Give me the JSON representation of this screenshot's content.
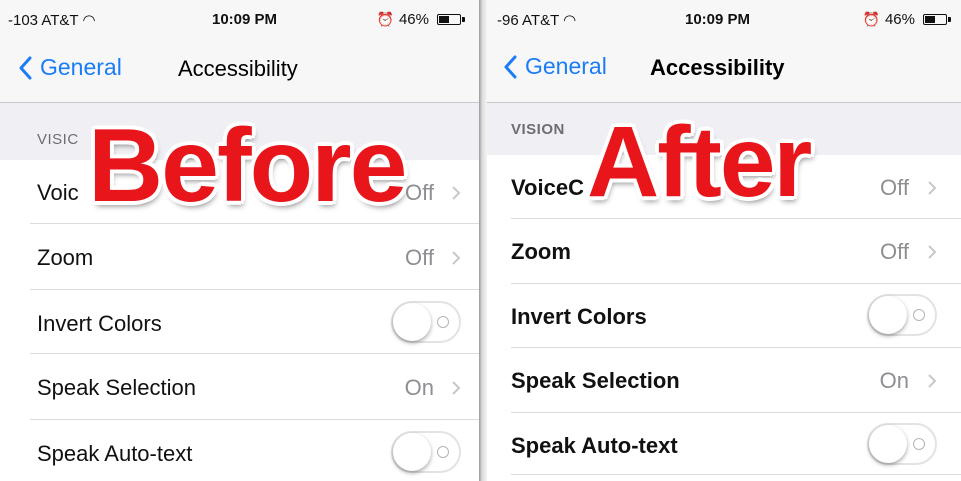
{
  "before": {
    "status_bar": {
      "carrier": "-103 AT&T",
      "time": "10:09 PM",
      "battery": "46%",
      "battery_level": 0.46
    },
    "nav": {
      "back_label": "General",
      "title": "Accessibility"
    },
    "section": {
      "title": "VISIC"
    },
    "rows": [
      {
        "label": "Voic",
        "value": "Off"
      },
      {
        "label": "Zoom",
        "value": "Off"
      },
      {
        "label": "Invert Colors",
        "toggle": "off"
      },
      {
        "label": "Speak Selection",
        "value": "On"
      },
      {
        "label": "Speak Auto-text",
        "toggle": "off"
      }
    ],
    "overlay_label": "Before"
  },
  "after": {
    "status_bar": {
      "carrier": "-96 AT&T",
      "time": "10:09 PM",
      "battery": "46%",
      "battery_level": 0.46
    },
    "nav": {
      "back_label": "General",
      "title": "Accessibility"
    },
    "section": {
      "title": "VISION"
    },
    "rows": [
      {
        "label": "VoiceC",
        "value": "Off"
      },
      {
        "label": "Zoom",
        "value": "Off"
      },
      {
        "label": "Invert Colors",
        "toggle": "off"
      },
      {
        "label": "Speak Selection",
        "value": "On"
      },
      {
        "label": "Speak Auto-text",
        "toggle": "off"
      }
    ],
    "overlay_label": "After"
  },
  "colors": {
    "accent": "#1a7cf6",
    "overlay_red": "#e8151b",
    "section_bg": "#efeff4"
  }
}
